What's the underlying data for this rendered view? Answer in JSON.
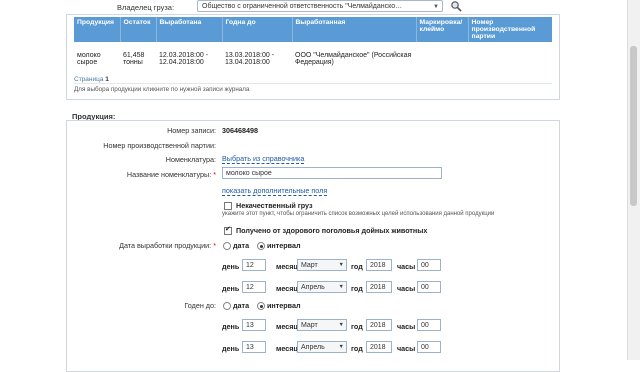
{
  "owner": {
    "label": "Владелец груза:",
    "value": "Общество с ограниченной ответственность \"Челмайданско…"
  },
  "grid": {
    "columns": [
      "Продукция",
      "Остаток",
      "Выработана",
      "Годна до",
      "Выработанная",
      "Маркировка/ клеймо",
      "Номер производственной партии"
    ],
    "rows": [
      {
        "product": "молоко сырое",
        "remainder": "61,458 тонны",
        "produced": "12.03.2018:00 - 12.04.2018:00",
        "expires": "13.03.2018:00 - 13.04.2018:00",
        "producer": "ООО \"Челмайданское\" (Российская Федерация)",
        "marking": "",
        "batch": ""
      }
    ]
  },
  "pager": {
    "label": "Страница",
    "page": "1"
  },
  "hint": "Для выбора продукции кликните по нужной записи журнала",
  "section_title": "Продукция:",
  "form": {
    "record_number_label": "Номер записи:",
    "record_number": "306468498",
    "batch_label": "Номер производственной партии:",
    "nomenclature_label": "Номенклатура:",
    "nomenclature_link": "Выбрать из справочника",
    "nomenclature_name_label": "Название номенклатуры:",
    "nomenclature_name_value": "молоко сырое",
    "extra_fields_link": "показать дополнительные поля",
    "low_quality_label": "Некачественный груз",
    "low_quality_note": "укажите этот пункт, чтобы ограничить список возможных целей использования данной продукции",
    "healthy_label": "Получено от здорового поголовья дойных животных",
    "production_date_label": "Дата выработки продукции:",
    "expiry_label": "Годен до:",
    "opt_date": "дата",
    "opt_interval": "интервал",
    "day_label": "день",
    "month_label": "месяц",
    "year_label": "год",
    "hours_label": "часы",
    "production_from": {
      "day": "12",
      "month": "Март",
      "year": "2018",
      "hours": "00"
    },
    "production_to": {
      "day": "12",
      "month": "Апрель",
      "year": "2018",
      "hours": "00"
    },
    "expiry_from": {
      "day": "13",
      "month": "Март",
      "year": "2018",
      "hours": "00"
    },
    "expiry_to": {
      "day": "13",
      "month": "Апрель",
      "year": "2018",
      "hours": "00"
    }
  },
  "required_mark": "*",
  "icons": {
    "search": "magnifier-icon",
    "dropdown": "chevron-down-icon"
  },
  "colors": {
    "header": "#5b9bd5",
    "link": "#1f5aa6"
  }
}
